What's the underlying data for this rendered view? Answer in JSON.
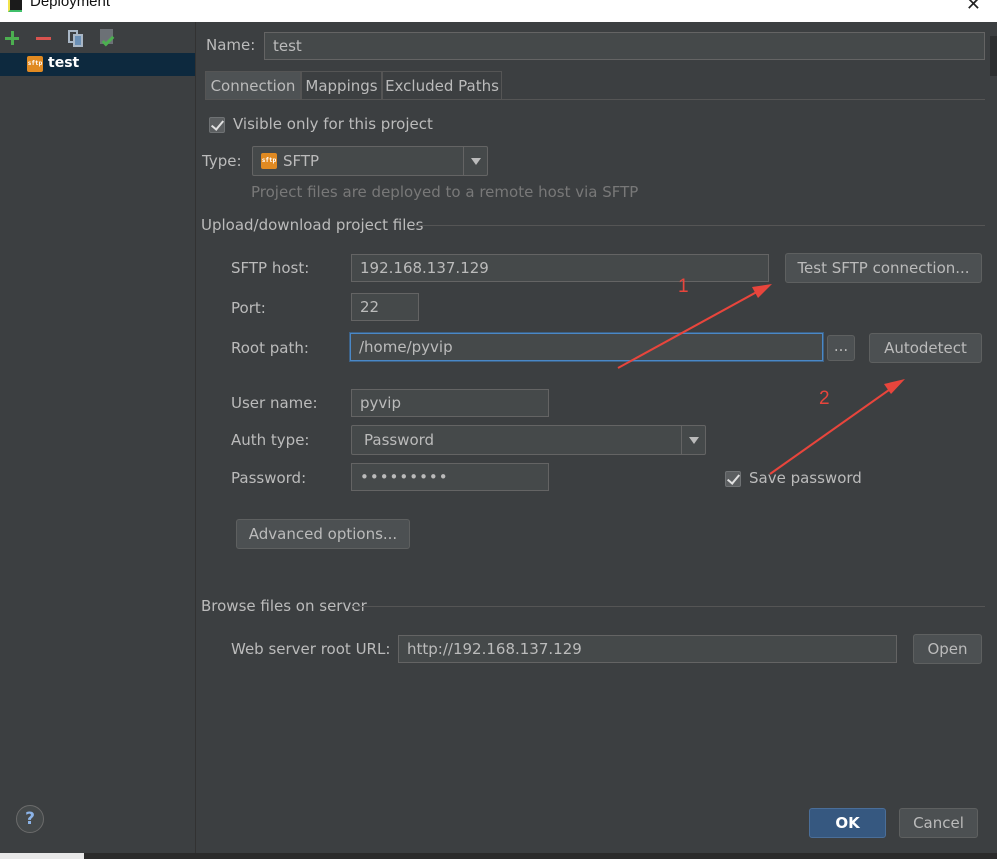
{
  "window": {
    "title": "Deployment",
    "close_symbol": "✕"
  },
  "toolbar": {
    "add_icon": "plus-icon",
    "remove_icon": "minus-icon",
    "copy_icon": "copy-icon",
    "default_icon": "set-default-icon"
  },
  "servers": [
    {
      "name": "test",
      "badge": "sftp",
      "selected": true
    }
  ],
  "name_label": "Name:",
  "name_value": "test",
  "tabs": [
    {
      "label": "Connection",
      "active": true
    },
    {
      "label": "Mappings",
      "active": false
    },
    {
      "label": "Excluded Paths",
      "active": false
    }
  ],
  "visible_only": {
    "label": "Visible only for this project",
    "checked": true
  },
  "type": {
    "label": "Type:",
    "value": "SFTP",
    "badge": "sftp",
    "hint": "Project files are deployed to a remote host via SFTP"
  },
  "upload_section": {
    "title": "Upload/download project files",
    "host_label": "SFTP host:",
    "host_value": "192.168.137.129",
    "test_button": "Test SFTP connection...",
    "port_label": "Port:",
    "port_value": "22",
    "root_label": "Root path:",
    "root_value": "/home/pyvip",
    "browse_button": "...",
    "autodetect_button": "Autodetect",
    "user_label": "User name:",
    "user_value": "pyvip",
    "auth_label": "Auth type:",
    "auth_value": "Password",
    "password_label": "Password:",
    "password_value": "•••••••••",
    "save_password": {
      "label": "Save password",
      "checked": true
    },
    "advanced_button": "Advanced options..."
  },
  "browse_section": {
    "title": "Browse files on server",
    "url_label": "Web server root URL:",
    "url_value": "http://192.168.137.129",
    "open_button": "Open"
  },
  "footer": {
    "help": "?",
    "ok": "OK",
    "cancel": "Cancel"
  },
  "annotations": {
    "marker_1": "1",
    "marker_2": "2",
    "color": "#e8453c"
  },
  "colors": {
    "dialog_bg": "#3c3f41",
    "field_bg": "#45494a",
    "selection": "#0d293e",
    "ok_button": "#365880"
  }
}
